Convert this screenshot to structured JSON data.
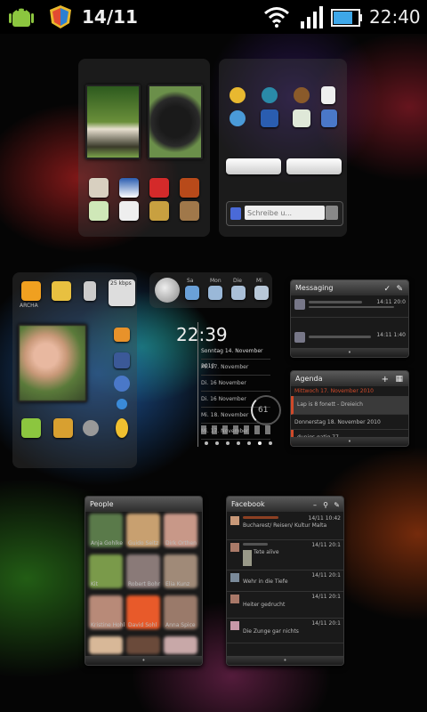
{
  "status_bar": {
    "date": "14/11",
    "time": "22:40"
  },
  "search_widget": {
    "placeholder": "Schreibe u..."
  },
  "folder_label": "ARCHA",
  "weather": {
    "days": [
      "Sa",
      "Mon",
      "Die",
      "Mi"
    ],
    "temp_label": "25 kbps"
  },
  "clock_widget": {
    "time": "22:39",
    "date_header": "Sonntag 14. November 2010",
    "dates": [
      "Mi. 17. November",
      "Di. 16 November",
      "Di. 16 November",
      "Mi. 18. November",
      "Mi. 17. November"
    ],
    "ring_value": "61"
  },
  "messaging_widget": {
    "title": "Messaging",
    "rows": [
      {
        "time": "14:11 20:0"
      },
      {
        "time": "14:11 1:40"
      }
    ]
  },
  "agenda_widget": {
    "title": "Agenda",
    "header": "Mittwoch 17. November 2010",
    "rows": [
      "Lap is 8 fonett - Dreieich",
      "Donnerstag 18. November 2010",
      "dunigs gatig 77"
    ]
  },
  "people_widget": {
    "title": "People",
    "names": [
      "Anja Gohlke",
      "Guido Seitz",
      "Dirk Orthen",
      "Kit",
      "Robert Bohr",
      "Elia Kunz",
      "Kristine Hohl",
      "David Sohl",
      "Anna Spice",
      "",
      "",
      ""
    ]
  },
  "facebook_widget": {
    "title": "Facebook",
    "rows": [
      {
        "text": "Bucharest/ Reisen/ Kultur Malta",
        "time": "14/11 10:42"
      },
      {
        "text": "Tete alive",
        "time": "14/11 20:1"
      },
      {
        "text": "Wehr in die Tiefe",
        "time": "14/11 20:1"
      },
      {
        "text": "Heiter gedrucht",
        "time": "14/11 20:1"
      },
      {
        "text": "Die Zunge gar nichts",
        "time": "14/11 20:1"
      }
    ]
  },
  "colors": {
    "accent_orange": "#d04a2a",
    "fb_blue": "#3b5998"
  }
}
